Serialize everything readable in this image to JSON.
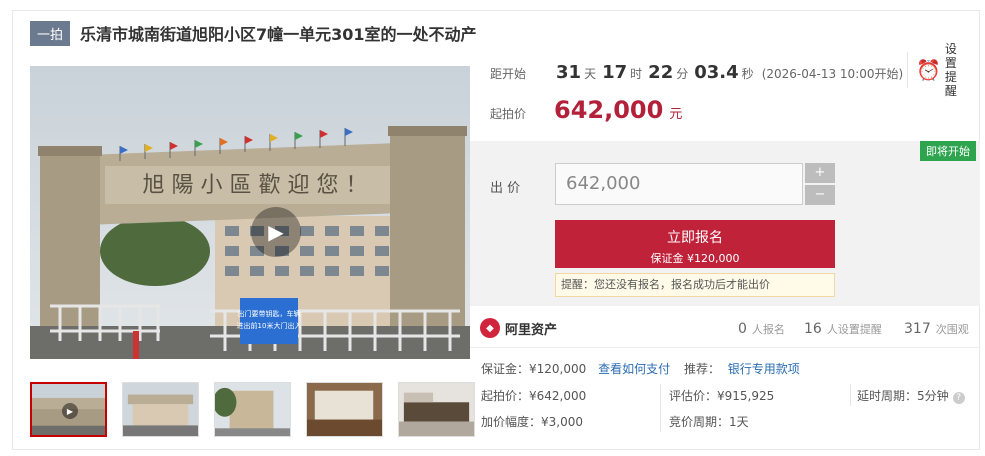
{
  "header": {
    "round_tag": "一拍",
    "title": "乐清市城南街道旭阳小区7幢一单元301室的一处不动产"
  },
  "countdown": {
    "label": "距开始",
    "days": "31",
    "days_unit": "天",
    "hours": "17",
    "hours_unit": "时",
    "minutes": "22",
    "minutes_unit": "分",
    "seconds": "03.4",
    "seconds_unit": "秒",
    "start_time": "(2026-04-13 10:00开始)"
  },
  "price": {
    "label": "起拍价",
    "value": "642,000",
    "unit": "元"
  },
  "remind": {
    "label": "设置提醒",
    "icon": "alarm-clock-icon"
  },
  "bid": {
    "status_badge": "即将开始",
    "label": "出 价",
    "input_value": "642,000",
    "plus": "+",
    "minus": "−",
    "signup_label": "立即报名",
    "deposit_line": "保证金 ¥120,000",
    "tip": "提醒：您还没有报名，报名成功后才能出价"
  },
  "stats": {
    "brand": "阿里资产",
    "signups_n": "0",
    "signups_label": "人报名",
    "reminders_n": "16",
    "reminders_label": "人设置提醒",
    "views_n": "317",
    "views_label": "次围观"
  },
  "details": {
    "deposit": "保证金：¥120,000",
    "how_to_pay": "查看如何支付",
    "recommend_label": "推荐：",
    "recommend_link": "银行专用款项",
    "start_price": "起拍价：¥642,000",
    "appraisal": "评估价：¥915,925",
    "delay": "延时周期：5分钟",
    "increment": "加价幅度：¥3,000",
    "cycle": "竞价周期：1天"
  },
  "media": {
    "main_banner_text": "旭 陽 小 區 歡 迎 您 ！",
    "sign_text_1": "出门要带钥匙，车辆",
    "sign_text_2": "进出前10米大门出入",
    "thumb_count": 5
  },
  "colors": {
    "accent_red": "#b3203a",
    "button_red": "#c0223a",
    "badge_green": "#2ea44f",
    "link_blue": "#2b6cb0",
    "tag_gray": "#6b7a8f"
  }
}
